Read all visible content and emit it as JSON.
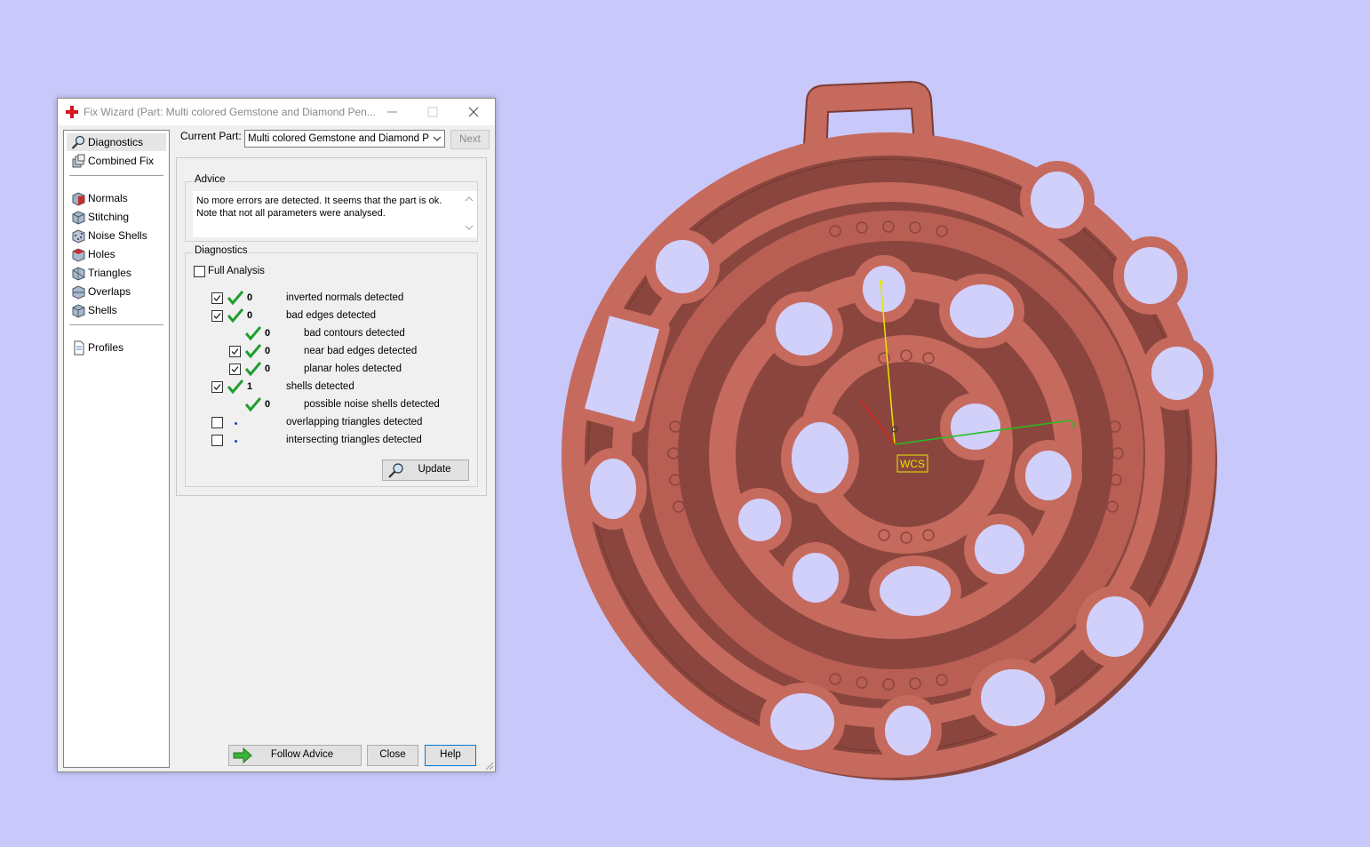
{
  "window": {
    "title": "Fix Wizard (Part: Multi colored Gemstone and Diamond Pen...",
    "minimize_icon": "minimize-icon",
    "maximize_icon": "maximize-icon",
    "close_icon": "close-icon"
  },
  "sidebar": {
    "items": [
      {
        "label": "Diagnostics",
        "icon": "magnifier-icon"
      },
      {
        "label": "Combined Fix",
        "icon": "layers-icon"
      },
      {
        "label": "Normals",
        "icon": "cube-normals-icon"
      },
      {
        "label": "Stitching",
        "icon": "cube-stitching-icon"
      },
      {
        "label": "Noise Shells",
        "icon": "cube-noise-icon"
      },
      {
        "label": "Holes",
        "icon": "cube-holes-icon"
      },
      {
        "label": "Triangles",
        "icon": "cube-triangles-icon"
      },
      {
        "label": "Overlaps",
        "icon": "cube-overlaps-icon"
      },
      {
        "label": "Shells",
        "icon": "cube-shells-icon"
      },
      {
        "label": "Profiles",
        "icon": "document-icon"
      }
    ]
  },
  "current_part": {
    "label": "Current Part:",
    "value": "Multi colored Gemstone and Diamond Penc",
    "next_label": "Next"
  },
  "advice": {
    "title": "Advice",
    "text": "No more errors are detected. It seems that the part is ok. Note that not all parameters were analysed."
  },
  "diagnostics": {
    "title": "Diagnostics",
    "full_analysis_label": "Full Analysis",
    "full_analysis_checked": false,
    "rows": [
      {
        "checked": true,
        "status": "ok",
        "count": "0",
        "label": "inverted normals detected"
      },
      {
        "checked": true,
        "status": "ok",
        "count": "0",
        "label": "bad edges detected"
      },
      {
        "checked": null,
        "status": "ok",
        "count": "0",
        "label": "bad contours detected"
      },
      {
        "checked": true,
        "status": "ok",
        "count": "0",
        "label": "near bad edges detected"
      },
      {
        "checked": true,
        "status": "ok",
        "count": "0",
        "label": "planar holes detected"
      },
      {
        "checked": true,
        "status": "ok",
        "count": "1",
        "label": "shells detected"
      },
      {
        "checked": null,
        "status": "ok",
        "count": "0",
        "label": "possible noise shells detected"
      },
      {
        "checked": false,
        "status": "unknown",
        "count": "",
        "label": "overlapping triangles detected"
      },
      {
        "checked": false,
        "status": "unknown",
        "count": "",
        "label": "intersecting triangles detected"
      }
    ],
    "update_label": "Update"
  },
  "footer": {
    "follow_advice_label": "Follow Advice",
    "close_label": "Close",
    "help_label": "Help"
  },
  "viewport": {
    "wcs_label": "WCS",
    "axis_y": "y",
    "axis_x": "x",
    "model": "pendant-model",
    "background_color": "#c8c8fa",
    "model_color": "#c26a5e"
  }
}
